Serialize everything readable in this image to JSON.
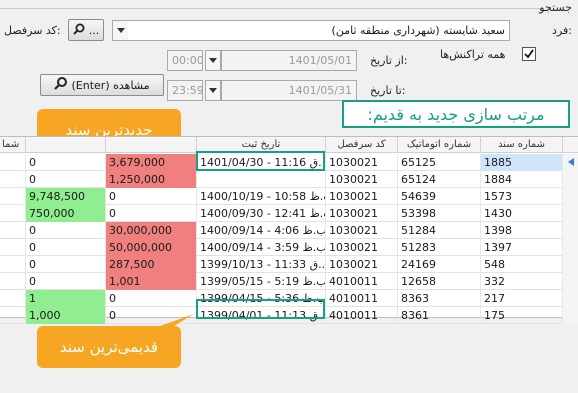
{
  "search": {
    "group_title": "جستجو",
    "person_label": "فرد:",
    "person_value": "سعید شایسته (شهرداری منطقه ثامن)",
    "ledger_code_label": "کد سرفصل:",
    "lookup_button_label": "...",
    "from_date_label": "از تاریخ:",
    "from_date_value": "1401/05/01",
    "from_time_value": "00:00",
    "to_date_label": "تا تاریخ:",
    "to_date_value": "1401/05/31",
    "to_time_value": "23:59",
    "all_transactions_label": "همه تراکنش‌ها",
    "view_button_label": "مشاهده (Enter)"
  },
  "annotations": {
    "sort_banner": "مرتب سازی جدید به قدیم:",
    "newest_label": "جدیدترین سند",
    "oldest_label": "قدیمی‌ترین سند"
  },
  "grid": {
    "columns": {
      "doc_no": "شماره سند",
      "auto_no": "شماره اتوماتیک",
      "ledger_code": "کد سرفصل",
      "reg_date": "تاریخ ثبت",
      "cut_col": "شما"
    },
    "rows": [
      {
        "doc_no": "1885",
        "auto_no": "65125",
        "ledger_code": "1030021",
        "reg_date": "1401/04/30 - 11:16 ق...",
        "amount_a": "3,679,000",
        "amount_b": "0",
        "selected": true
      },
      {
        "doc_no": "1884",
        "auto_no": "65124",
        "ledger_code": "1030021",
        "reg_date": "",
        "amount_a": "1,250,000",
        "amount_b": "0",
        "selected": false
      },
      {
        "doc_no": "1573",
        "auto_no": "54639",
        "ledger_code": "1030021",
        "reg_date": "1400/10/19 - 10:58 ب.ظ",
        "amount_a": "0",
        "amount_b": "9,748,500",
        "selected": false
      },
      {
        "doc_no": "1430",
        "auto_no": "53398",
        "ledger_code": "1030021",
        "reg_date": "1400/09/30 - 12:41 ب.ظ",
        "amount_a": "0",
        "amount_b": "750,000",
        "selected": false
      },
      {
        "doc_no": "1398",
        "auto_no": "51284",
        "ledger_code": "1030021",
        "reg_date": "1400/09/14 - 4:06 ب.ظ",
        "amount_a": "30,000,000",
        "amount_b": "0",
        "selected": false
      },
      {
        "doc_no": "1397",
        "auto_no": "51283",
        "ledger_code": "1030021",
        "reg_date": "1400/09/14 - 3:59 ب.ظ",
        "amount_a": "50,000,000",
        "amount_b": "0",
        "selected": false
      },
      {
        "doc_no": "548",
        "auto_no": "24169",
        "ledger_code": "1030021",
        "reg_date": "1399/10/13 - 11:33 ق...",
        "amount_a": "287,500",
        "amount_b": "0",
        "selected": false
      },
      {
        "doc_no": "332",
        "auto_no": "12658",
        "ledger_code": "4010011",
        "reg_date": "1399/05/15 - 5:19 ب.ظ",
        "amount_a": "1,001",
        "amount_b": "0",
        "selected": false
      },
      {
        "doc_no": "217",
        "auto_no": "8363",
        "ledger_code": "4010011",
        "reg_date": "1399/04/15 - 5:36 ب.ظ",
        "amount_a": "0",
        "amount_b": "1",
        "selected": false
      },
      {
        "doc_no": "175",
        "auto_no": "8361",
        "ledger_code": "4010011",
        "reg_date": "1399/04/01 - 11:13 ق...",
        "amount_a": "0",
        "amount_b": "1,000",
        "selected": false
      }
    ]
  },
  "colors": {
    "debit_red": "#f08080",
    "credit_green": "#90ee90",
    "selection_blue": "#cfe3fb",
    "accent_orange": "#f6a623",
    "teal": "#16a085"
  },
  "icons": {
    "search": "search-icon",
    "dropdown": "chevron-down-icon",
    "checkbox": "check-icon",
    "row_pointer": "row-indicator-icon"
  }
}
